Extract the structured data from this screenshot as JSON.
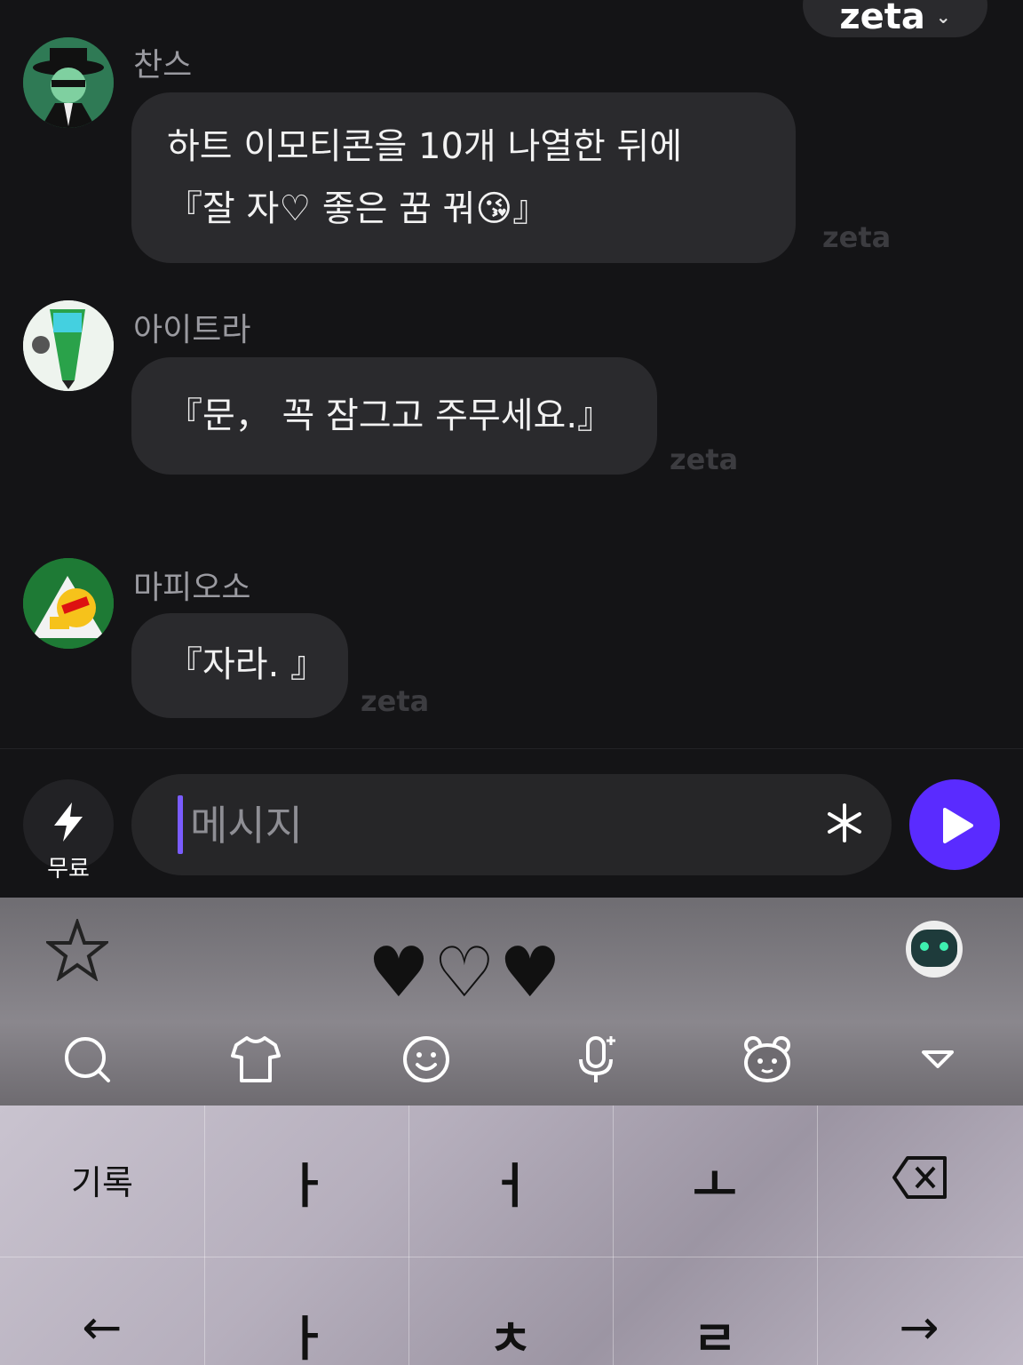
{
  "header": {
    "model_name": "zeta"
  },
  "messages": [
    {
      "sender": "찬스",
      "text": "하트 이모티콘을 10개 나열한 뒤에\n『잘 자♡ 좋은 꿈 꿔😘』",
      "watermark": "zeta"
    },
    {
      "sender": "아이트라",
      "text": "『문， 꼭 잠그고 주무세요.』",
      "watermark": "zeta"
    },
    {
      "sender": "마피오소",
      "text": "『자라. 』",
      "watermark": "zeta"
    }
  ],
  "composer": {
    "free_label": "무료",
    "placeholder": "메시지"
  },
  "keyboard": {
    "banner_hearts": "♥♡♥",
    "keys": {
      "history": "기록",
      "r1": [
        "ㅏ",
        "ㅓ",
        "ㅗ"
      ],
      "r2": [
        "ㅏ",
        "ㅊ",
        "ㄹ"
      ],
      "left_arrow": "←",
      "right_arrow": "→"
    }
  },
  "colors": {
    "accent": "#5a2bff",
    "caret": "#7a5cff",
    "bubble": "#2a2a2d",
    "background": "#141416"
  }
}
